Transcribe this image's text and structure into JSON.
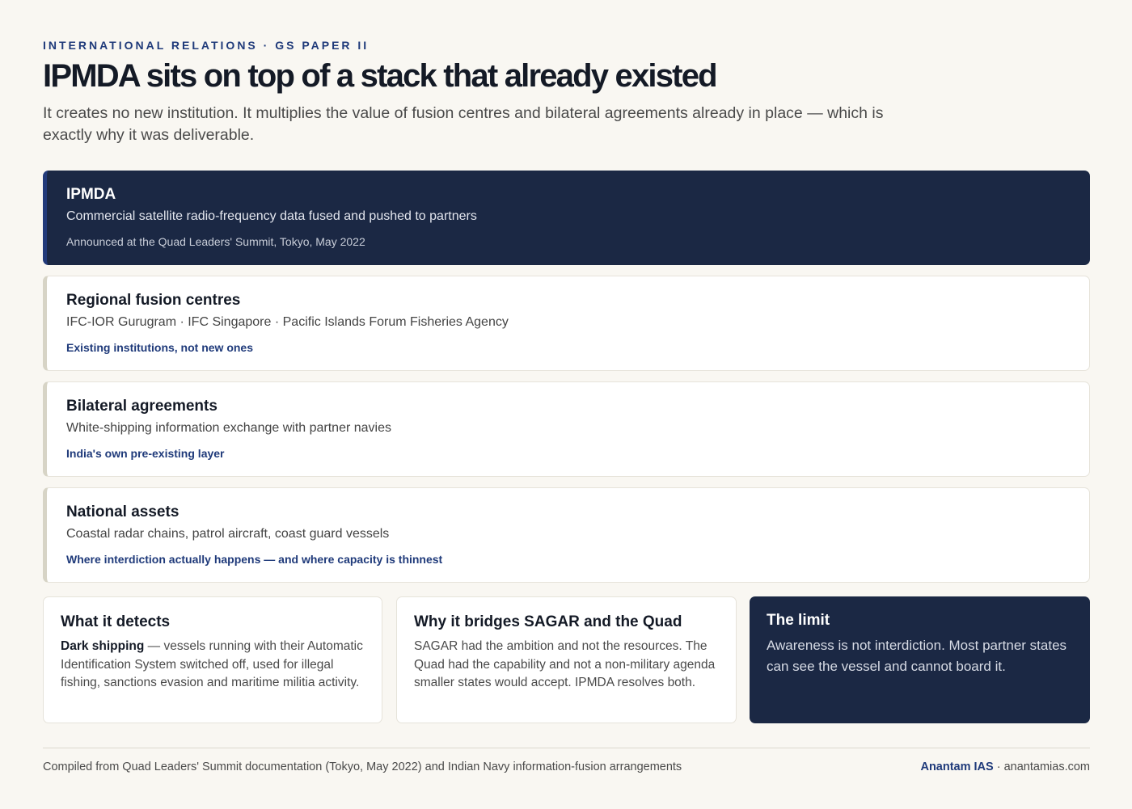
{
  "header": {
    "kicker": "INTERNATIONAL RELATIONS · GS PAPER II",
    "title": "IPMDA sits on top of a stack that already existed",
    "subtitle": "It creates no new institution. It multiplies the value of fusion centres and bilateral agreements already in place — which is exactly why it was deliverable."
  },
  "stack": [
    {
      "title": "IPMDA",
      "description": "Commercial satellite radio-frequency data fused and pushed to partners",
      "note": "Announced at the Quad Leaders' Summit, Tokyo, May 2022"
    },
    {
      "title": "Regional fusion centres",
      "description": "IFC-IOR Gurugram · IFC Singapore · Pacific Islands Forum Fisheries Agency",
      "note": "Existing institutions, not new ones"
    },
    {
      "title": "Bilateral agreements",
      "description": "White-shipping information exchange with partner navies",
      "note": "India's own pre-existing layer"
    },
    {
      "title": "National assets",
      "description": "Coastal radar chains, patrol aircraft, coast guard vessels",
      "note": "Where interdiction actually happens — and where capacity is thinnest"
    }
  ],
  "cards": {
    "detects": {
      "title": "What it detects",
      "lead": "Dark shipping",
      "body": " — vessels running with their Automatic Identification System switched off, used for illegal fishing, sanctions evasion and maritime militia activity."
    },
    "bridges": {
      "title": "Why it bridges SAGAR and the Quad",
      "body": "SAGAR had the ambition and not the resources. The Quad had the capability and not a non-military agenda smaller states would accept. IPMDA resolves both."
    },
    "limit": {
      "title": "The limit",
      "body": "Awareness is not interdiction. Most partner states can see the vessel and cannot board it."
    }
  },
  "footer": {
    "source": "Compiled from Quad Leaders' Summit documentation (Tokyo, May 2022) and Indian Navy information-fusion arrangements",
    "brand_name": "Anantam IAS",
    "brand_separator": " · ",
    "brand_site": "anantamias.com"
  }
}
